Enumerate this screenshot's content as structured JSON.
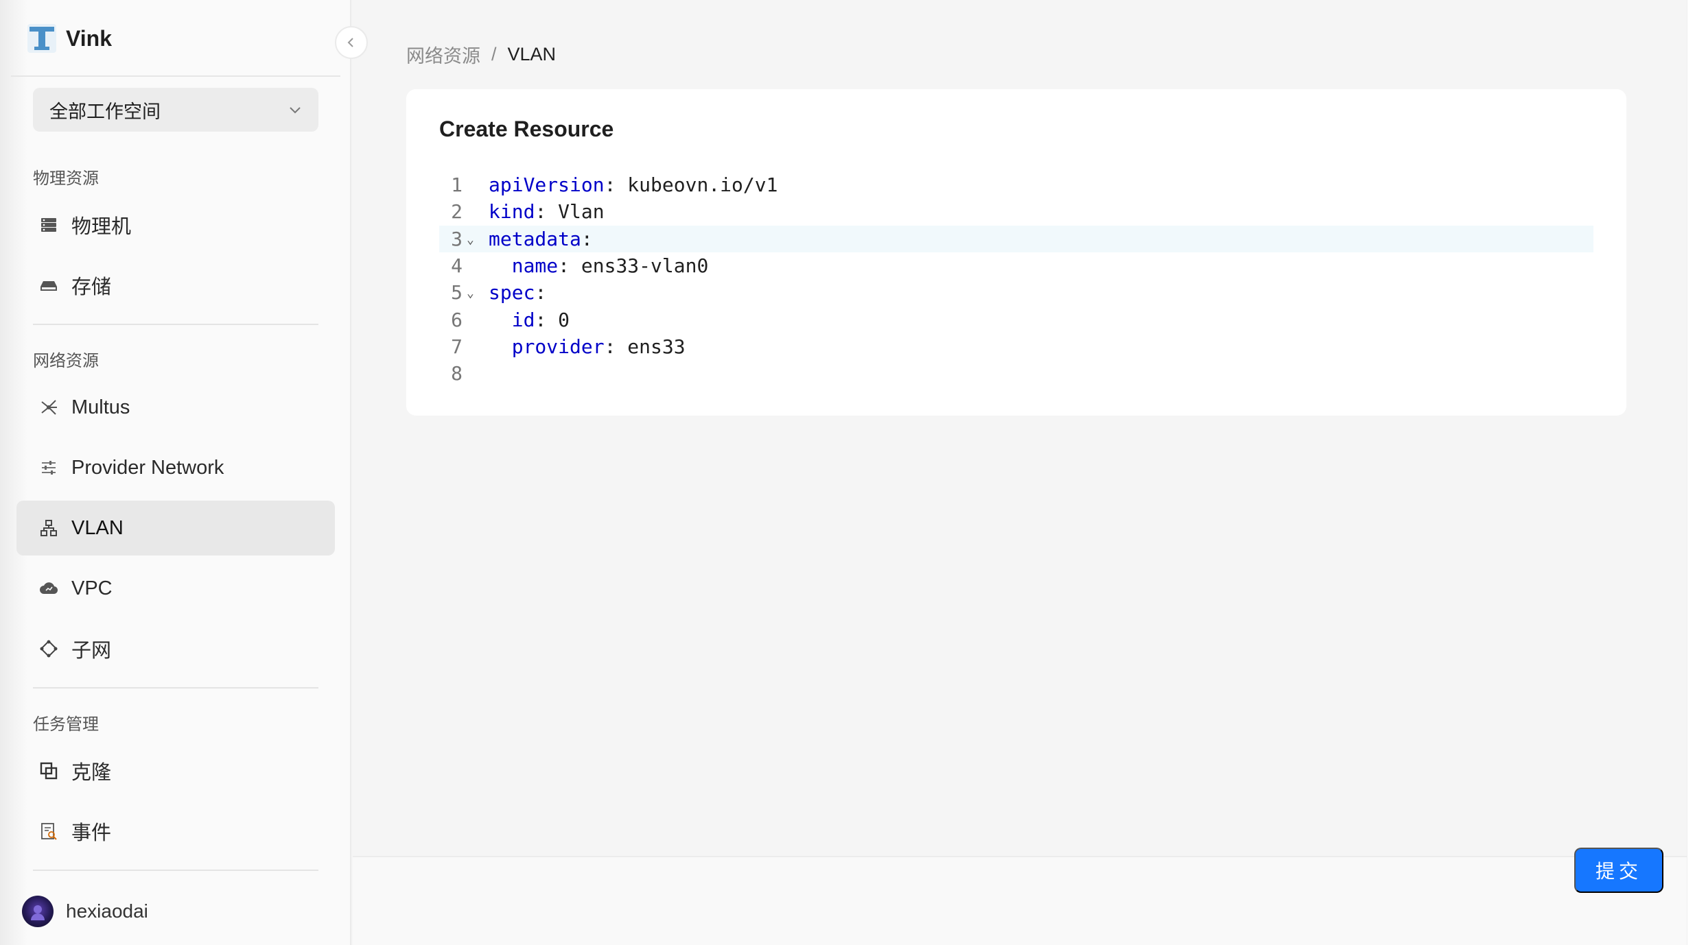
{
  "brand": {
    "name": "Vink"
  },
  "workspace": {
    "selected": "全部工作空间"
  },
  "sidebar": {
    "groups": [
      {
        "title": "物理资源",
        "items": [
          {
            "label": "物理机",
            "icon": "server-icon"
          },
          {
            "label": "存储",
            "icon": "storage-icon"
          }
        ]
      },
      {
        "title": "网络资源",
        "items": [
          {
            "label": "Multus",
            "icon": "multus-icon"
          },
          {
            "label": "Provider Network",
            "icon": "sliders-icon"
          },
          {
            "label": "VLAN",
            "icon": "network-tree-icon"
          },
          {
            "label": "VPC",
            "icon": "cloud-icon"
          },
          {
            "label": "子网",
            "icon": "subnet-icon"
          }
        ]
      },
      {
        "title": "任务管理",
        "items": [
          {
            "label": "克隆",
            "icon": "clone-icon"
          },
          {
            "label": "事件",
            "icon": "event-icon"
          }
        ]
      }
    ],
    "active_item": "VLAN"
  },
  "user": {
    "name": "hexiaodai"
  },
  "breadcrumb": {
    "parent": "网络资源",
    "separator": "/",
    "current": "VLAN"
  },
  "card": {
    "title": "Create Resource"
  },
  "editor": {
    "active_line": 3,
    "lines": [
      {
        "n": "1",
        "key": "apiVersion",
        "value": "kubeovn.io/v1",
        "indent": ""
      },
      {
        "n": "2",
        "key": "kind",
        "value": "Vlan",
        "indent": ""
      },
      {
        "n": "3",
        "key": "metadata",
        "value": "",
        "indent": "",
        "foldable": true
      },
      {
        "n": "4",
        "key": "name",
        "value": "ens33-vlan0",
        "indent": "  "
      },
      {
        "n": "5",
        "key": "spec",
        "value": "",
        "indent": "",
        "foldable": true
      },
      {
        "n": "6",
        "key": "id",
        "value": "0",
        "indent": "  "
      },
      {
        "n": "7",
        "key": "provider",
        "value": "ens33",
        "indent": "  "
      },
      {
        "n": "8",
        "key": "",
        "value": "",
        "indent": ""
      }
    ]
  },
  "actions": {
    "submit_label": "提交"
  },
  "colors": {
    "accent": "#1677ff",
    "yaml_key": "#0000c8"
  }
}
